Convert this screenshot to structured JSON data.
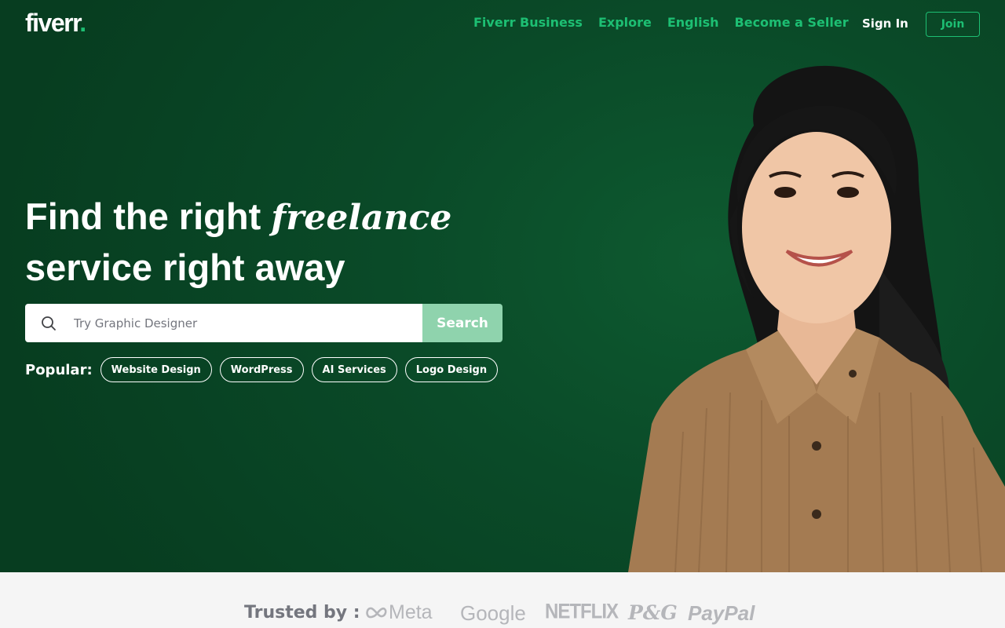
{
  "header": {
    "logo_text": "fiverr",
    "logo_dot": ".",
    "nav": [
      "Fiverr Business",
      "Explore",
      "English",
      "Become a Seller"
    ],
    "signin_label": "Sign In",
    "join_label": "Join"
  },
  "hero": {
    "headline_part1": "Find the right ",
    "headline_italic": "freelance",
    "headline_part2": "service right away"
  },
  "search": {
    "placeholder": "Try Graphic Designer",
    "button_label": "Search",
    "icon": "search-icon"
  },
  "popular": {
    "label": "Popular:",
    "chips": [
      "Website Design",
      "WordPress",
      "AI Services",
      "Logo Design"
    ]
  },
  "trusted": {
    "label": "Trusted by :",
    "brands": [
      "Meta",
      "Google",
      "NETFLIX",
      "P&G",
      "PayPal"
    ]
  },
  "colors": {
    "brand_green": "#1dbf73",
    "hero_bg": "#0a4a28",
    "search_button": "#8fd3ad"
  }
}
